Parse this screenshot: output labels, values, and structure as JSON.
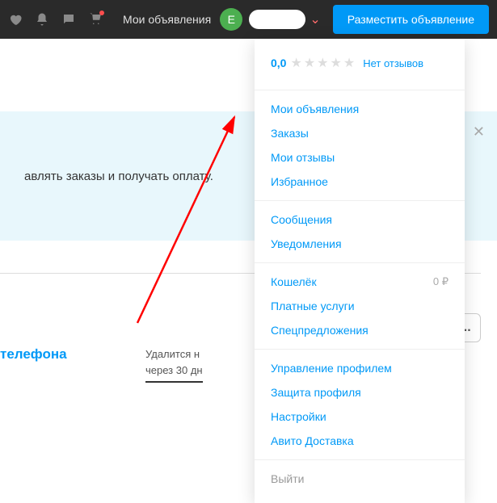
{
  "header": {
    "my_ads_label": "Мои объявления",
    "avatar_letter": "E",
    "post_button_label": "Разместить объявление"
  },
  "dropdown": {
    "rating_value": "0,0",
    "reviews_label": "Нет отзывов",
    "group1": [
      {
        "label": "Мои объявления"
      },
      {
        "label": "Заказы"
      },
      {
        "label": "Мои отзывы"
      },
      {
        "label": "Избранное"
      }
    ],
    "group2": [
      {
        "label": "Сообщения"
      },
      {
        "label": "Уведомления"
      }
    ],
    "group3": [
      {
        "label": "Кошелёк",
        "value": "0 ₽"
      },
      {
        "label": "Платные услуги"
      },
      {
        "label": "Спецпредложения"
      }
    ],
    "group4": [
      {
        "label": "Управление профилем"
      },
      {
        "label": "Защита профиля"
      },
      {
        "label": "Настройки"
      },
      {
        "label": "Авито Доставка"
      }
    ],
    "logout_label": "Выйти"
  },
  "info_box": {
    "text": "авлять заказы и получать оплату."
  },
  "bottom": {
    "phone_title": "телефона",
    "delete_line1": "Удалится н",
    "delete_line2": "через 30 дн",
    "more_dots": "..."
  }
}
